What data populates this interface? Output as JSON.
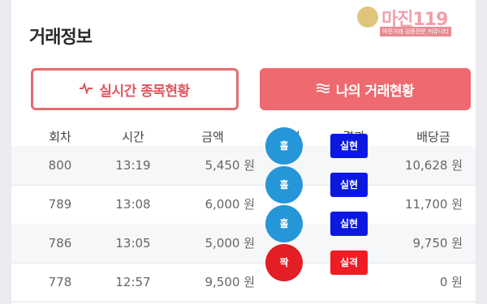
{
  "page": {
    "title": "거래정보"
  },
  "watermark": {
    "logo": "마진119",
    "tagline": "마진거래 검증전문 커뮤니티"
  },
  "buttons": {
    "live": {
      "label": "실시간 종목현황",
      "icon": "pulse-icon"
    },
    "mine": {
      "label": "나의 거래현황",
      "icon": "waves-icon"
    }
  },
  "table": {
    "headers": [
      "회차",
      "시간",
      "금액",
      "체결",
      "결과",
      "배당금"
    ],
    "rows": [
      {
        "round": "800",
        "time": "13:19",
        "amount": "5,450 원",
        "pick": "홀",
        "pick_color": "#2596d8",
        "result": "실현",
        "result_color": "#0a18e0",
        "payout": "10,628 원"
      },
      {
        "round": "789",
        "time": "13:08",
        "amount": "6,000 원",
        "pick": "홀",
        "pick_color": "#2596d8",
        "result": "실현",
        "result_color": "#0a18e0",
        "payout": "11,700 원"
      },
      {
        "round": "786",
        "time": "13:05",
        "amount": "5,000 원",
        "pick": "홀",
        "pick_color": "#2596d8",
        "result": "실현",
        "result_color": "#0a18e0",
        "payout": "9,750 원"
      },
      {
        "round": "778",
        "time": "12:57",
        "amount": "9,500 원",
        "pick": "짝",
        "pick_color": "#e41e25",
        "result": "실격",
        "result_color": "#f01c24",
        "payout": "0 원"
      }
    ]
  }
}
